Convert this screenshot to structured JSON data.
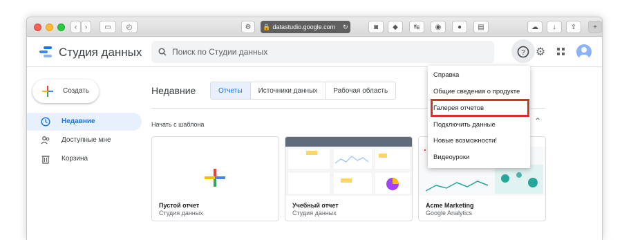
{
  "browser": {
    "url": "datastudio.google.com"
  },
  "header": {
    "app_title": "Студия данных",
    "search_placeholder": "Поиск по Студии данных"
  },
  "sidebar": {
    "create_label": "Создать",
    "items": [
      {
        "label": "Недавние",
        "icon": "clock-icon",
        "active": true
      },
      {
        "label": "Доступные мне",
        "icon": "people-icon",
        "active": false
      },
      {
        "label": "Корзина",
        "icon": "trash-icon",
        "active": false
      }
    ]
  },
  "main": {
    "title": "Недавние",
    "tabs": [
      "Отчеты",
      "Источники данных",
      "Рабочая область"
    ],
    "active_tab": 0,
    "templates_title": "Начать с шаблона",
    "templates": [
      {
        "name": "Пустой отчет",
        "source": "Студия данных"
      },
      {
        "name": "Учебный отчет",
        "source": "Студия данных"
      },
      {
        "name": "Acme Marketing",
        "source": "Google Analytics"
      }
    ]
  },
  "help_menu": {
    "items": [
      "Справка",
      "Общие сведения о продукте",
      "Галерея отчетов",
      "Подключить данные",
      "Новые возможности!",
      "Видеоуроки"
    ],
    "highlighted_index": 2,
    "highlight_color": "#d93025"
  },
  "colors": {
    "accent": "#1a73e8",
    "active_bg": "#e8f0fe"
  }
}
